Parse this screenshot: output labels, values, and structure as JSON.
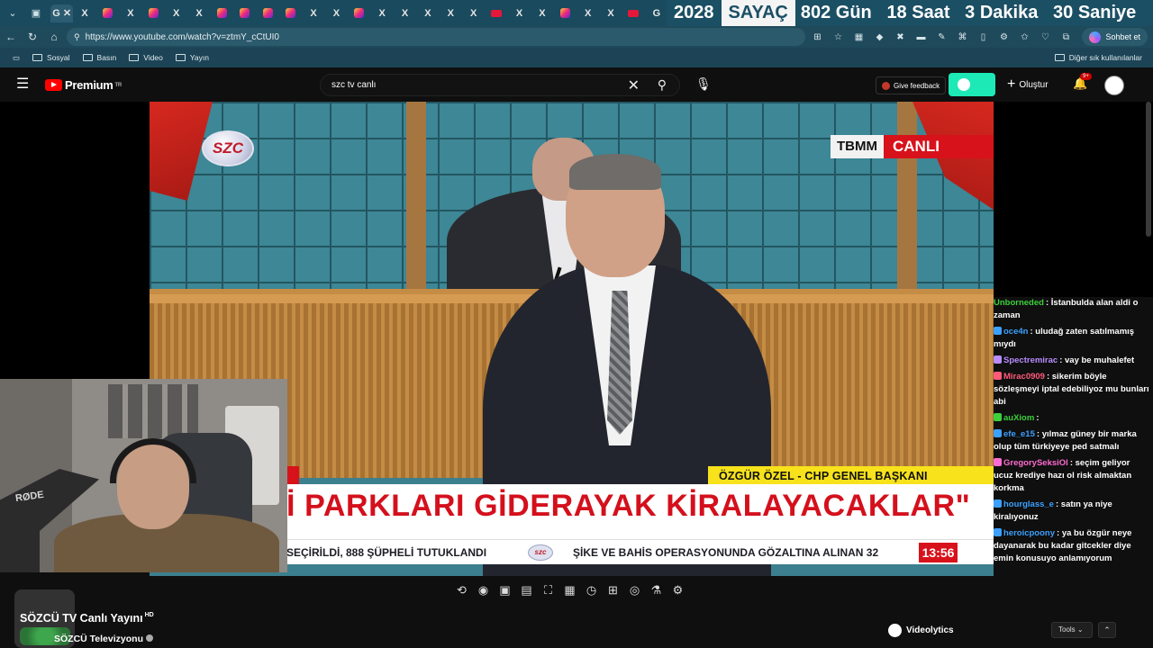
{
  "browser": {
    "counter": {
      "year": "2028",
      "label": "SAYAÇ",
      "days": "802 Gün",
      "hours": "18 Saat",
      "minutes": "3 Dakika",
      "seconds": "30 Saniye"
    },
    "url": "https://www.youtube.com/watch?v=ztmY_cCtUI0",
    "chat_button": "Sohbet et",
    "bookmarks": [
      "Sosyal",
      "Basın",
      "Video",
      "Yayın"
    ],
    "bookmarks_right": "Diğer sık kullanılanlar"
  },
  "youtube": {
    "logo": "Premium",
    "logo_sup": "TR",
    "search_value": "szc tv canlı",
    "feedback": "Give feedback",
    "create": "Oluştur",
    "notif_count": "9+"
  },
  "video": {
    "channel_logo": "SZC",
    "live_tag_a": "TBMM",
    "live_tag_b": "CANLI",
    "nameplate": "ÖZGÜR ÖZEL - CHP GENEL BAŞKANI",
    "headline": "İ PARKLARI GİDERAYAK KİRALAYACAKLAR\"",
    "ticker_1": "SEÇİRİLDİ, 888 ŞÜPHELİ TUTUKLANDI",
    "ticker_logo": "szc",
    "ticker_2": "ŞİKE VE BAHİS OPERASYONUNDA GÖZALTINA ALINAN 32",
    "clock": "13:56",
    "cam_mic_brand": "RØDE"
  },
  "chat": [
    {
      "user": "Unborneded",
      "color": "#3cd13c",
      "text": "İstanbulda alan aldi o zaman"
    },
    {
      "user": "oce4n",
      "color": "#3ca0ff",
      "text": "uludağ zaten satılmamış mıydı"
    },
    {
      "user": "Spectremirac",
      "color": "#b98cff",
      "text": "vay be muhalefet"
    },
    {
      "user": "Mirac0909",
      "color": "#ff5a7a",
      "text": "sikerim böyle sözleşmeyi iptal edebiliyoz mu bunları abi"
    },
    {
      "user": "auXiom",
      "color": "#3cd13c",
      "text": ""
    },
    {
      "user": "efe_e15",
      "color": "#3ca0ff",
      "text": "yılmaz güney bir marka olup tüm türkiyeye ped satmalı"
    },
    {
      "user": "GregorySeksiOl",
      "color": "#ff6bd1",
      "text": "seçim geliyor ucuz krediye hazı ol risk almaktan korkma"
    },
    {
      "user": "hourglass_e",
      "color": "#3ca0ff",
      "text": "satın ya niye kiralıyonuz"
    },
    {
      "user": "heroicpoony",
      "color": "#3ca0ff",
      "text": "ya bu özgür neye dayanarak bu kadar gitcekler diye emin konusuyo anlamıyorum"
    }
  ],
  "below": {
    "title": "SÖZCÜ TV Canlı Yayını",
    "hd": "HD",
    "channel": "SÖZCÜ Televizyonu",
    "videolytics": "Videolytics",
    "tools": "Tools"
  }
}
